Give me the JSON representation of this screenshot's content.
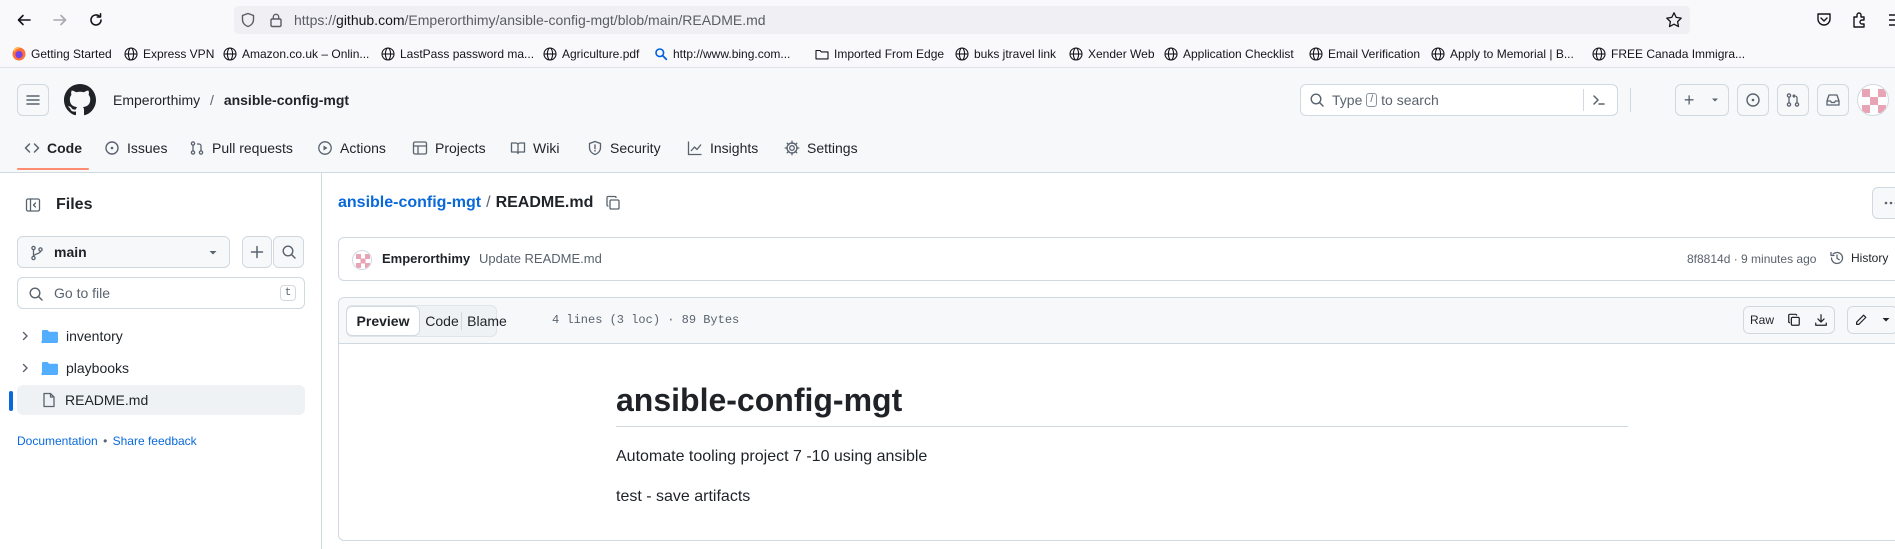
{
  "browser": {
    "url_prefix": "https://",
    "url_host": "github.com",
    "url_path": "/Emperorthimy/ansible-config-mgt/blob/main/README.md",
    "bookmarks": [
      "Getting Started",
      "Express VPN",
      "Amazon.co.uk – Onlin...",
      "LastPass password ma...",
      "Agriculture.pdf",
      "http://www.bing.com...",
      "Imported From Edge",
      "buks jtravel link",
      "Xender Web",
      "Application Checklist",
      "Email Verification",
      "Apply to Memorial | B...",
      "FREE Canada Immigra..."
    ]
  },
  "header": {
    "owner": "Emperorthimy",
    "separator": "/",
    "repo": "ansible-config-mgt",
    "search_placeholder_pre": "Type",
    "search_key": "/",
    "search_placeholder_post": "to search",
    "plus": "+"
  },
  "tabs": [
    "Code",
    "Issues",
    "Pull requests",
    "Actions",
    "Projects",
    "Wiki",
    "Security",
    "Insights",
    "Settings"
  ],
  "sidebar": {
    "title": "Files",
    "branch": "main",
    "goto_placeholder": "Go to file",
    "goto_shortcut": "t",
    "tree": [
      {
        "name": "inventory",
        "type": "folder"
      },
      {
        "name": "playbooks",
        "type": "folder"
      },
      {
        "name": "README.md",
        "type": "file"
      }
    ],
    "documentation": "Documentation",
    "bullet": "•",
    "feedback": "Share feedback"
  },
  "file": {
    "repo_link": "ansible-config-mgt",
    "separator": "/",
    "filename": "README.md",
    "commit_author": "Emperorthimy",
    "commit_message": "Update README.md",
    "commit_meta": "8f8814d · 9 minutes ago",
    "history": "History",
    "view_tabs": [
      "Preview",
      "Code",
      "Blame"
    ],
    "stats": "4 lines (3 loc) · 89 Bytes",
    "raw": "Raw"
  },
  "readme": {
    "heading": "ansible-config-mgt",
    "paragraphs": [
      "Automate tooling project 7 -10 using ansible",
      "test - save artifacts"
    ]
  },
  "colors": {
    "accent_underline": "#fd8c73",
    "link": "#0969da",
    "folder": "#54aeff",
    "selected_indicator": "#0969da"
  }
}
